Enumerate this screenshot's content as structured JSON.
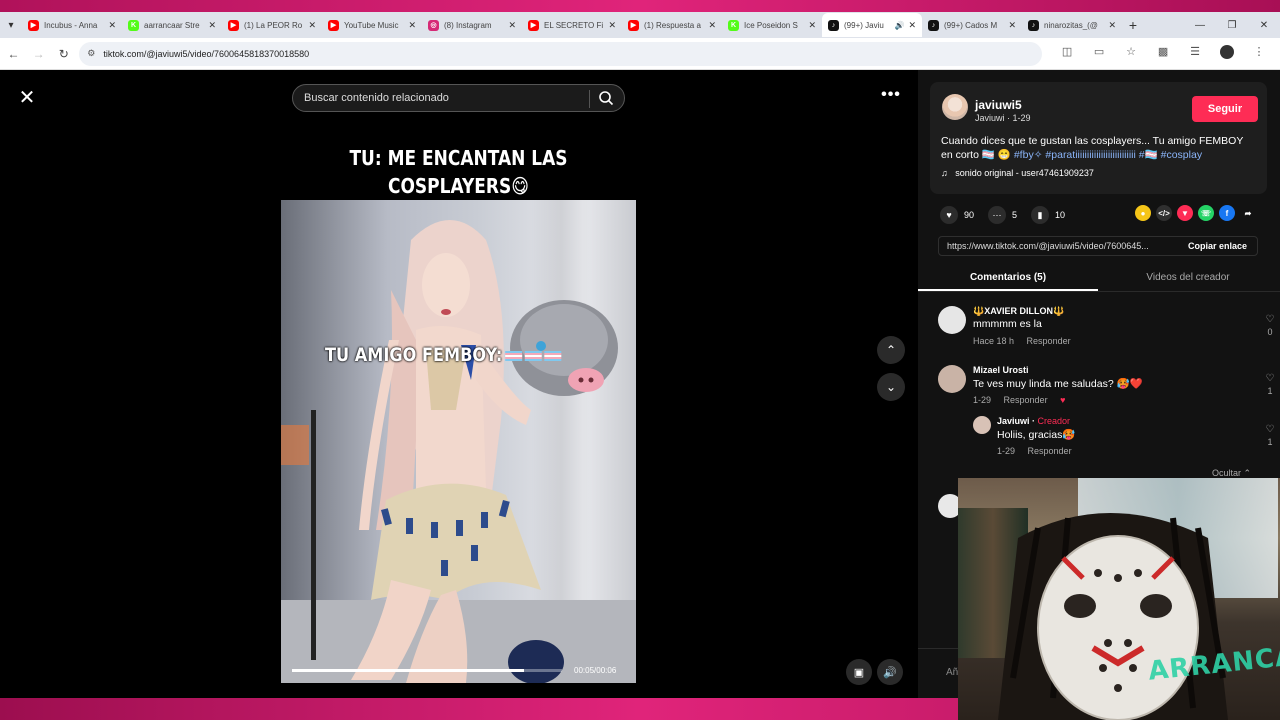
{
  "browser": {
    "tabs": [
      {
        "label": "Incubus - Anna",
        "favicon": "youtube",
        "color": "#ff0000",
        "active": false
      },
      {
        "label": "aarrancaar Stre",
        "favicon": "kick",
        "color": "#53fc18",
        "active": false
      },
      {
        "label": "(1) La PEOR Ro",
        "favicon": "youtube",
        "color": "#ff0000",
        "active": false
      },
      {
        "label": "YouTube Music",
        "favicon": "youtube-music",
        "color": "#ff0000",
        "active": false
      },
      {
        "label": "(8) Instagram",
        "favicon": "instagram",
        "color": "#d62976",
        "active": false
      },
      {
        "label": "EL SECRETO Fi",
        "favicon": "youtube",
        "color": "#ff0000",
        "active": false
      },
      {
        "label": "(1) Respuesta a",
        "favicon": "youtube",
        "color": "#ff0000",
        "active": false
      },
      {
        "label": "Ice Poseidon S",
        "favicon": "kick",
        "color": "#53fc18",
        "active": false
      },
      {
        "label": "(99+) Javiu",
        "favicon": "tiktok",
        "color": "#111111",
        "active": true
      },
      {
        "label": "(99+) Cados M",
        "favicon": "tiktok",
        "color": "#111111",
        "active": false
      },
      {
        "label": "ninarozitas_(@",
        "favicon": "tiktok",
        "color": "#111111",
        "active": false
      }
    ],
    "url": "tiktok.com/@javiuwi5/video/7600645818370018580"
  },
  "video": {
    "search_placeholder": "Buscar contenido relacionado",
    "caption_top_line1": "TU: ME ENCANTAN LAS",
    "caption_top_line2": "COSPLAYERS😋",
    "caption_mid": "TU AMIGO FEMBOY:",
    "time": "00:05/00:06",
    "progress_fraction": 0.86
  },
  "author": {
    "username": "javiuwi5",
    "subline": "Javiuwi · 1-29",
    "follow_label": "Seguir",
    "description_text": "Cuando dices que te gustan las cosplayers... Tu amigo FEMBOY en corto 🏳️‍⚧️ 😁 ",
    "tags": [
      "#fby✧",
      "#paratiiiiiiiiiiiiiiiiiiiiiiiiii",
      "#🏳️‍⚧️",
      "#cosplay"
    ],
    "sound": "sonido original - user47461909237"
  },
  "stats": {
    "likes": "90",
    "comments": "5",
    "saves": "10"
  },
  "link": {
    "url": "https://www.tiktok.com/@javiuwi5/video/7600645...",
    "copy_label": "Copiar enlace"
  },
  "panel_tabs": {
    "comments": "Comentarios (5)",
    "creator_videos": "Videos del creador"
  },
  "comments": [
    {
      "name": "🔱XAVIER DILLON🔱",
      "text": "mmmmm es la",
      "time": "Hace 18 h",
      "reply": "Responder",
      "likes": "0"
    },
    {
      "name": "Mizael Urosti",
      "text": "Te ves muy linda me saludas? 🥵❤️",
      "time": "1-29",
      "reply": "Responder",
      "likes": "1"
    },
    {
      "name": "Javiuwi",
      "creator_label": "Creador",
      "text": "Holiis, gracias🥵",
      "time": "1-29",
      "reply": "Responder",
      "likes": "1"
    }
  ],
  "hide_label": "Ocultar",
  "add_comment_placeholder": "Añ",
  "webcam": {
    "watermark": "ARRANCAR"
  }
}
